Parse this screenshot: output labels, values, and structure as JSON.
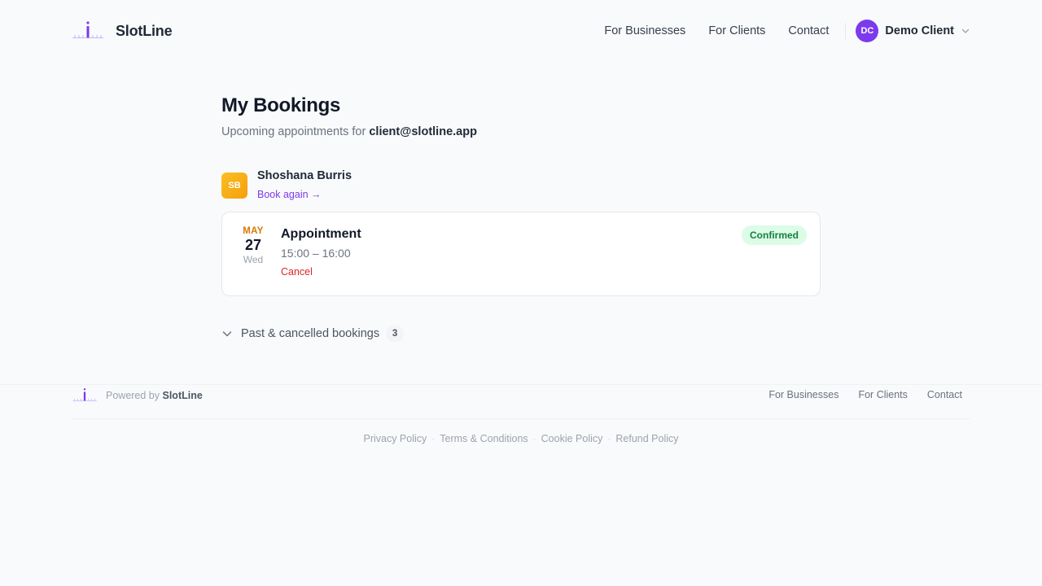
{
  "header": {
    "brand_name": "SlotLine",
    "nav": [
      {
        "label": "For Businesses"
      },
      {
        "label": "For Clients"
      },
      {
        "label": "Contact"
      }
    ],
    "user": {
      "initials": "DC",
      "name": "Demo Client"
    }
  },
  "main": {
    "title": "My Bookings",
    "subtitle_prefix": "Upcoming appointments for",
    "email": "client@slotline.app",
    "provider": {
      "initials": "SB",
      "name": "Shoshana Burris",
      "book_again": "Book again →"
    },
    "booking": {
      "month": "MAY",
      "day": "27",
      "weekday": "Wed",
      "title": "Appointment",
      "time": "15:00 – 16:00",
      "cancel_label": "Cancel",
      "status": "Confirmed"
    },
    "past": {
      "label": "Past & cancelled bookings",
      "count": "3"
    }
  },
  "footer": {
    "powered_prefix": "Powered by",
    "powered_name": "SlotLine",
    "nav": [
      {
        "label": "For Businesses"
      },
      {
        "label": "For Clients"
      },
      {
        "label": "Contact"
      }
    ],
    "legal": [
      {
        "label": "Privacy Policy"
      },
      {
        "label": "Terms & Conditions"
      },
      {
        "label": "Cookie Policy"
      },
      {
        "label": "Refund Policy"
      }
    ]
  },
  "colors": {
    "accent": "#7c3aed",
    "provider_avatar": "#f59e0b",
    "confirmed_bg": "#dcfce7",
    "confirmed_text": "#15803d",
    "cancel": "#dc2626",
    "month": "#d97706"
  },
  "icons": {
    "brand": "slotline-logo-icon",
    "user_menu": "chevron-down-icon",
    "past_toggle": "chevron-down-icon"
  }
}
